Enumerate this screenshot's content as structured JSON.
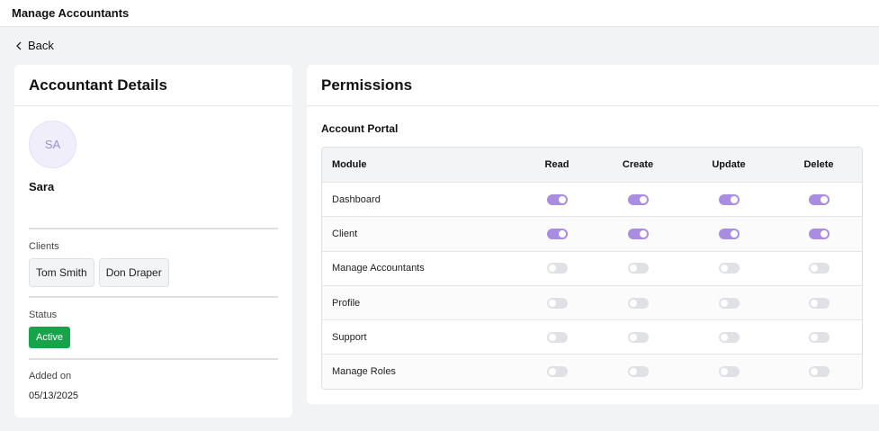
{
  "header": {
    "title": "Manage Accountants"
  },
  "back_label": "Back",
  "accountant": {
    "heading": "Accountant Details",
    "initials": "SA",
    "name": "Sara",
    "clients_label": "Clients",
    "clients": [
      "Tom Smith",
      "Don Draper"
    ],
    "status_label": "Status",
    "status": "Active",
    "added_label": "Added on",
    "added_on": "05/13/2025"
  },
  "permissions": {
    "heading": "Permissions",
    "section": "Account Portal",
    "columns": [
      "Module",
      "Read",
      "Create",
      "Update",
      "Delete"
    ],
    "rows": [
      {
        "module": "Dashboard",
        "read": true,
        "create": true,
        "update": true,
        "delete": true
      },
      {
        "module": "Client",
        "read": true,
        "create": true,
        "update": true,
        "delete": true
      },
      {
        "module": "Manage Accountants",
        "read": false,
        "create": false,
        "update": false,
        "delete": false
      },
      {
        "module": "Profile",
        "read": false,
        "create": false,
        "update": false,
        "delete": false
      },
      {
        "module": "Support",
        "read": false,
        "create": false,
        "update": false,
        "delete": false
      },
      {
        "module": "Manage Roles",
        "read": false,
        "create": false,
        "update": false,
        "delete": false
      }
    ]
  },
  "colors": {
    "accent": "#a98de0",
    "status_active": "#17a34a"
  }
}
